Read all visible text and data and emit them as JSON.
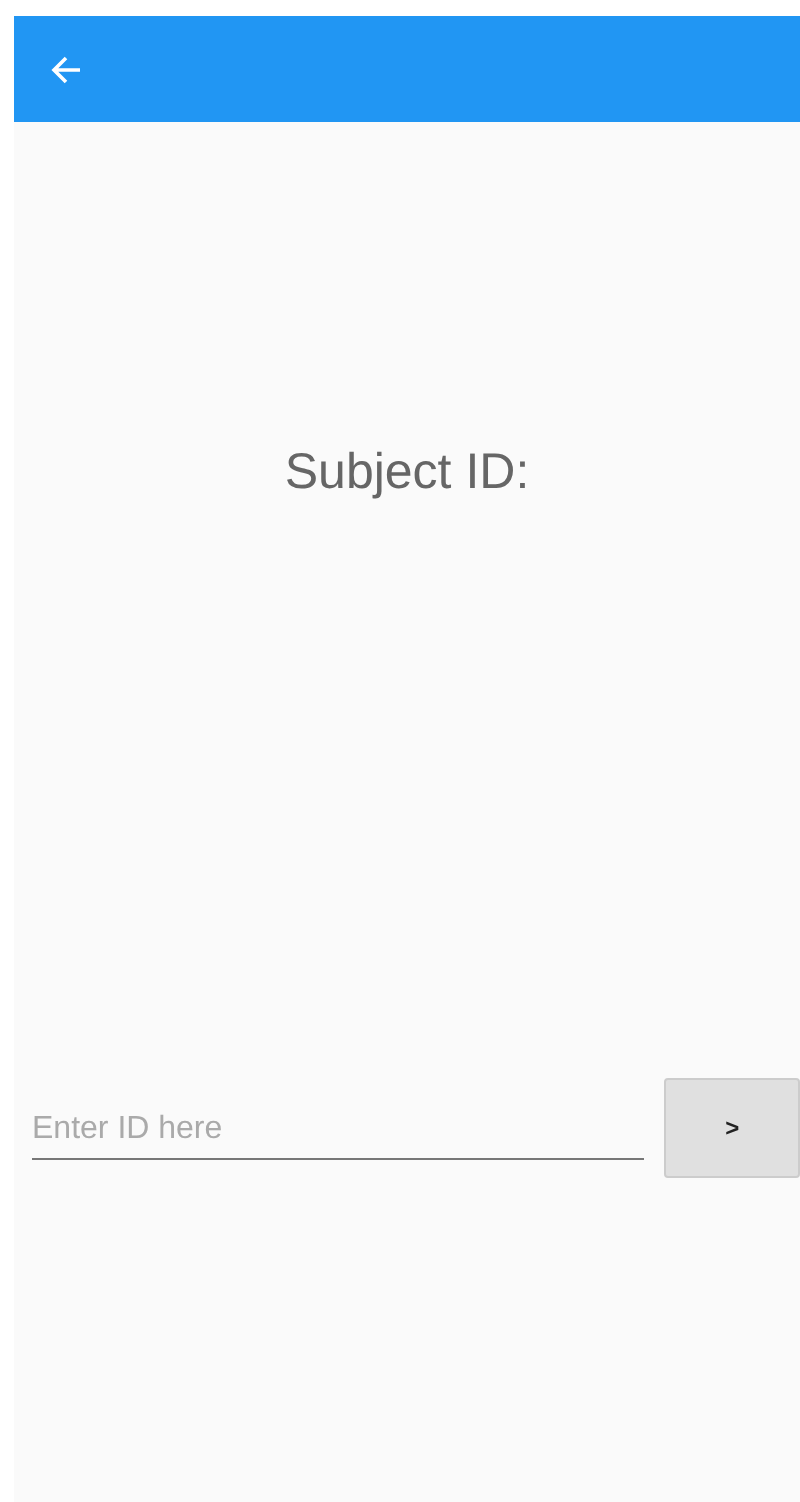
{
  "title": "Subject ID:",
  "id_field": {
    "placeholder": "Enter ID here"
  },
  "next_button": {
    "label": ">"
  }
}
